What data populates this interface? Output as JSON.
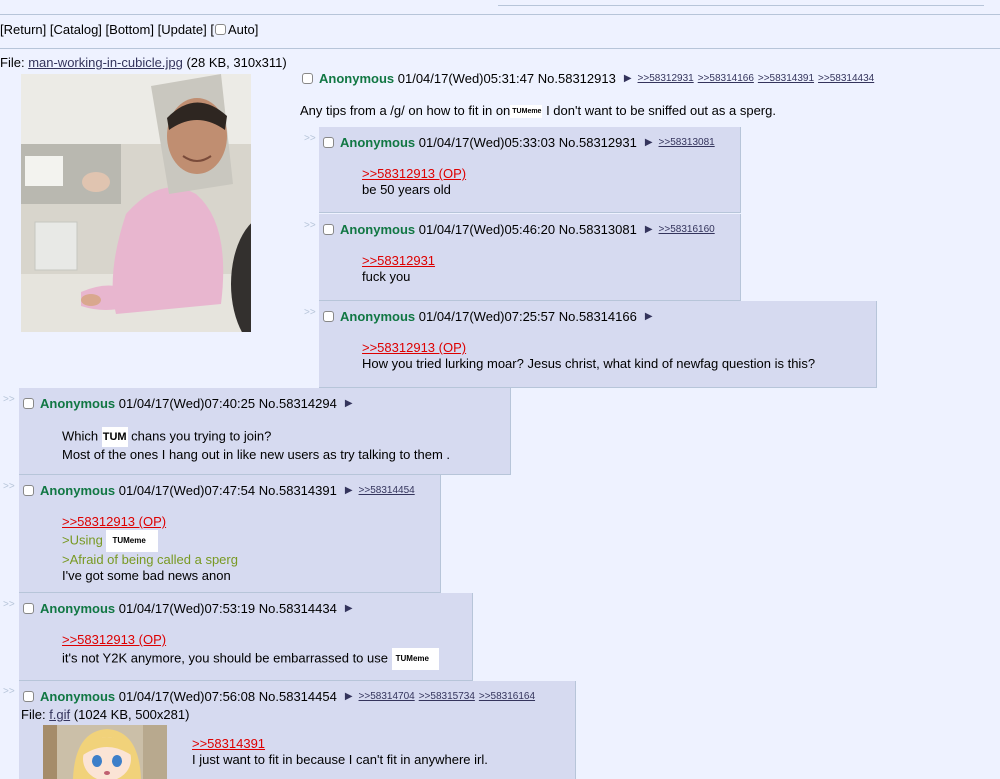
{
  "nav": {
    "return": "[Return]",
    "catalog": "[Catalog]",
    "bottom": "[Bottom]",
    "update": "[Update]",
    "bracket_open": "[",
    "auto": "Auto]"
  },
  "op": {
    "file_prefix": "File:",
    "file_name": "man-working-in-cubicle.jpg",
    "file_info": "(28 KB, 310x311)",
    "name": "Anonymous",
    "datetime": "01/04/17(Wed)05:31:47",
    "post_no": "No.58312913",
    "backlinks": [
      ">>58312931",
      ">>58314166",
      ">>58314391",
      ">>58314434"
    ],
    "message_before": "Any tips from a /g/ on how to fit in on",
    "tag": "TUMeme",
    "message_after": " I don't want to be sniffed out as a sperg."
  },
  "replies": [
    {
      "name": "Anonymous",
      "datetime": "01/04/17(Wed)05:33:03",
      "post_no": "No.58312931",
      "backlinks": [
        ">>58313081"
      ],
      "quote": ">>58312913 (OP)",
      "text": "be 50 years old"
    },
    {
      "name": "Anonymous",
      "datetime": "01/04/17(Wed)05:46:20",
      "post_no": "No.58313081",
      "backlinks": [
        ">>58316160"
      ],
      "quote": ">>58312931",
      "text": "fuck you"
    },
    {
      "name": "Anonymous",
      "datetime": "01/04/17(Wed)07:25:57",
      "post_no": "No.58314166",
      "backlinks": [],
      "quote": ">>58312913 (OP)",
      "text": "How you tried lurking moar? Jesus christ, what kind of newfag question is this?"
    },
    {
      "name": "Anonymous",
      "datetime": "01/04/17(Wed)07:40:25",
      "post_no": "No.58314294",
      "backlinks": [],
      "line1_before": "Which ",
      "tag": "TUM",
      "line1_after": " chans you trying to join?",
      "line2": "Most of the ones I hang out in like new users as try talking to them ."
    },
    {
      "name": "Anonymous",
      "datetime": "01/04/17(Wed)07:47:54",
      "post_no": "No.58314391",
      "backlinks": [
        ">>58314454"
      ],
      "quote": ">>58312913 (OP)",
      "green1": ">Using ",
      "tag": "TUMeme",
      "green2": ">Afraid of being called a sperg",
      "text": "I've got some bad news anon"
    },
    {
      "name": "Anonymous",
      "datetime": "01/04/17(Wed)07:53:19",
      "post_no": "No.58314434",
      "backlinks": [],
      "quote": ">>58312913 (OP)",
      "text": "it's not Y2K anymore, you should be embarrassed to use ",
      "tag": "TUMeme"
    },
    {
      "name": "Anonymous",
      "datetime": "01/04/17(Wed)07:56:08",
      "post_no": "No.58314454",
      "backlinks": [
        ">>58314704",
        ">>58315734",
        ">>58316164"
      ],
      "file_prefix": "File:",
      "file_name": "f.gif",
      "file_info": "(1024 KB, 500x281)",
      "quote": ">>58314391",
      "text": "I just want to fit in because I can't fit in anywhere irl."
    }
  ],
  "ui": {
    "side_arrows": ">>",
    "post_arrow": "▶"
  },
  "colors": {
    "background": "#eef2ff",
    "reply_bg": "#d6daf0",
    "name": "#117743",
    "quote": "#dd0000",
    "greentext": "#789922",
    "link": "#34345c"
  }
}
